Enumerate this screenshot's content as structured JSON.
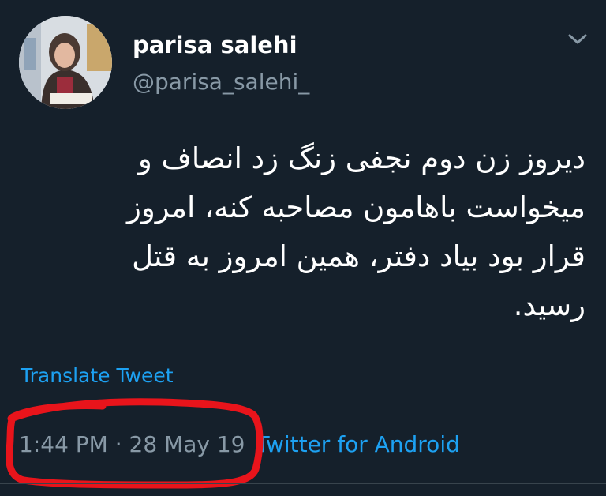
{
  "tweet": {
    "author": {
      "display_name": "parisa salehi",
      "handle": "@parisa_salehi_"
    },
    "text": "دیروز زن دوم نجفی زنگ زد انصاف و\nمیخواست باهامون مصاحبه کنه، امروز\nقرار بود بیاد دفتر، همین امروز به قتل\nرسید.",
    "translate_label": "Translate Tweet",
    "timestamp": "1:44 PM · 28 May 19",
    "source": "Twitter for Android"
  },
  "icons": {
    "menu": "chevron-down-icon",
    "avatar": "profile-photo"
  },
  "colors": {
    "background": "#15202b",
    "accent": "#1da1f2",
    "secondary_text": "#8899a6",
    "annotation": "#e8141b"
  }
}
